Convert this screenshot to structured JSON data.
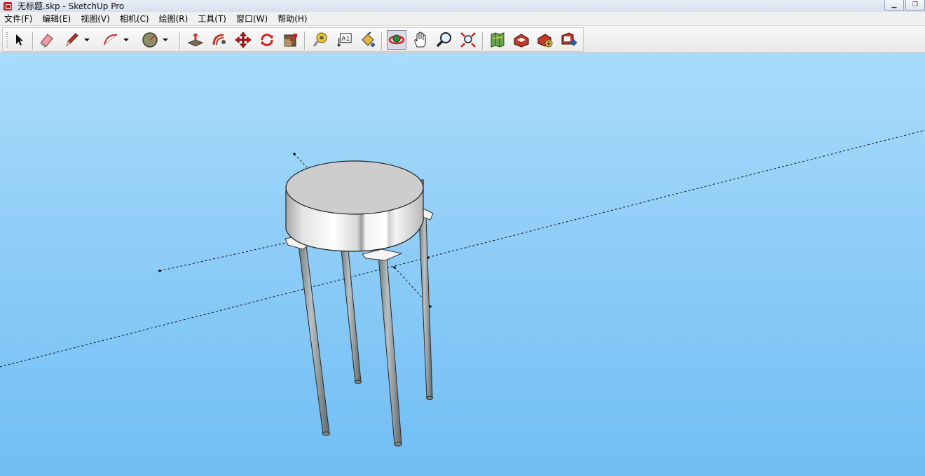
{
  "window": {
    "title": "无标题.skp - SketchUp Pro",
    "controls": [
      "minimize",
      "maximize"
    ]
  },
  "menu": {
    "items": [
      {
        "label": "文件(F)"
      },
      {
        "label": "编辑(E)"
      },
      {
        "label": "视图(V)"
      },
      {
        "label": "相机(C)"
      },
      {
        "label": "绘图(R)"
      },
      {
        "label": "工具(T)"
      },
      {
        "label": "窗口(W)"
      },
      {
        "label": "帮助(H)"
      }
    ]
  },
  "toolbar": {
    "tools": [
      {
        "name": "select-tool",
        "icon": "arrow-cursor-icon"
      },
      {
        "name": "eraser-tool",
        "icon": "eraser-icon"
      },
      {
        "name": "pencil-tool",
        "icon": "pencil-icon"
      },
      {
        "name": "arc-tool",
        "icon": "arc-icon"
      },
      {
        "name": "circle-tool",
        "icon": "circle-icon"
      },
      {
        "name": "push-pull-tool",
        "icon": "push-pull-icon"
      },
      {
        "name": "follow-me-tool",
        "icon": "follow-me-icon"
      },
      {
        "name": "move-tool",
        "icon": "move-icon"
      },
      {
        "name": "rotate-tool",
        "icon": "rotate-icon"
      },
      {
        "name": "scale-tool",
        "icon": "scale-icon"
      },
      {
        "name": "tape-measure-tool",
        "icon": "tape-measure-icon"
      },
      {
        "name": "text-tool",
        "icon": "text-label-icon",
        "label": "A1"
      },
      {
        "name": "paint-bucket-tool",
        "icon": "paint-bucket-icon"
      },
      {
        "name": "orbit-tool",
        "icon": "orbit-icon",
        "active": true
      },
      {
        "name": "pan-tool",
        "icon": "hand-icon"
      },
      {
        "name": "zoom-tool",
        "icon": "magnifier-icon"
      },
      {
        "name": "zoom-extents-tool",
        "icon": "zoom-extents-icon"
      },
      {
        "name": "add-location-tool",
        "icon": "map-icon"
      },
      {
        "name": "3d-warehouse-tool",
        "icon": "warehouse-icon"
      },
      {
        "name": "get-models-tool",
        "icon": "get-models-icon"
      },
      {
        "name": "share-model-tool",
        "icon": "share-model-icon"
      }
    ]
  },
  "viewport": {
    "model": "transistor-to-package",
    "background_top": "#a9dcfb",
    "background_bottom": "#70bef4"
  }
}
